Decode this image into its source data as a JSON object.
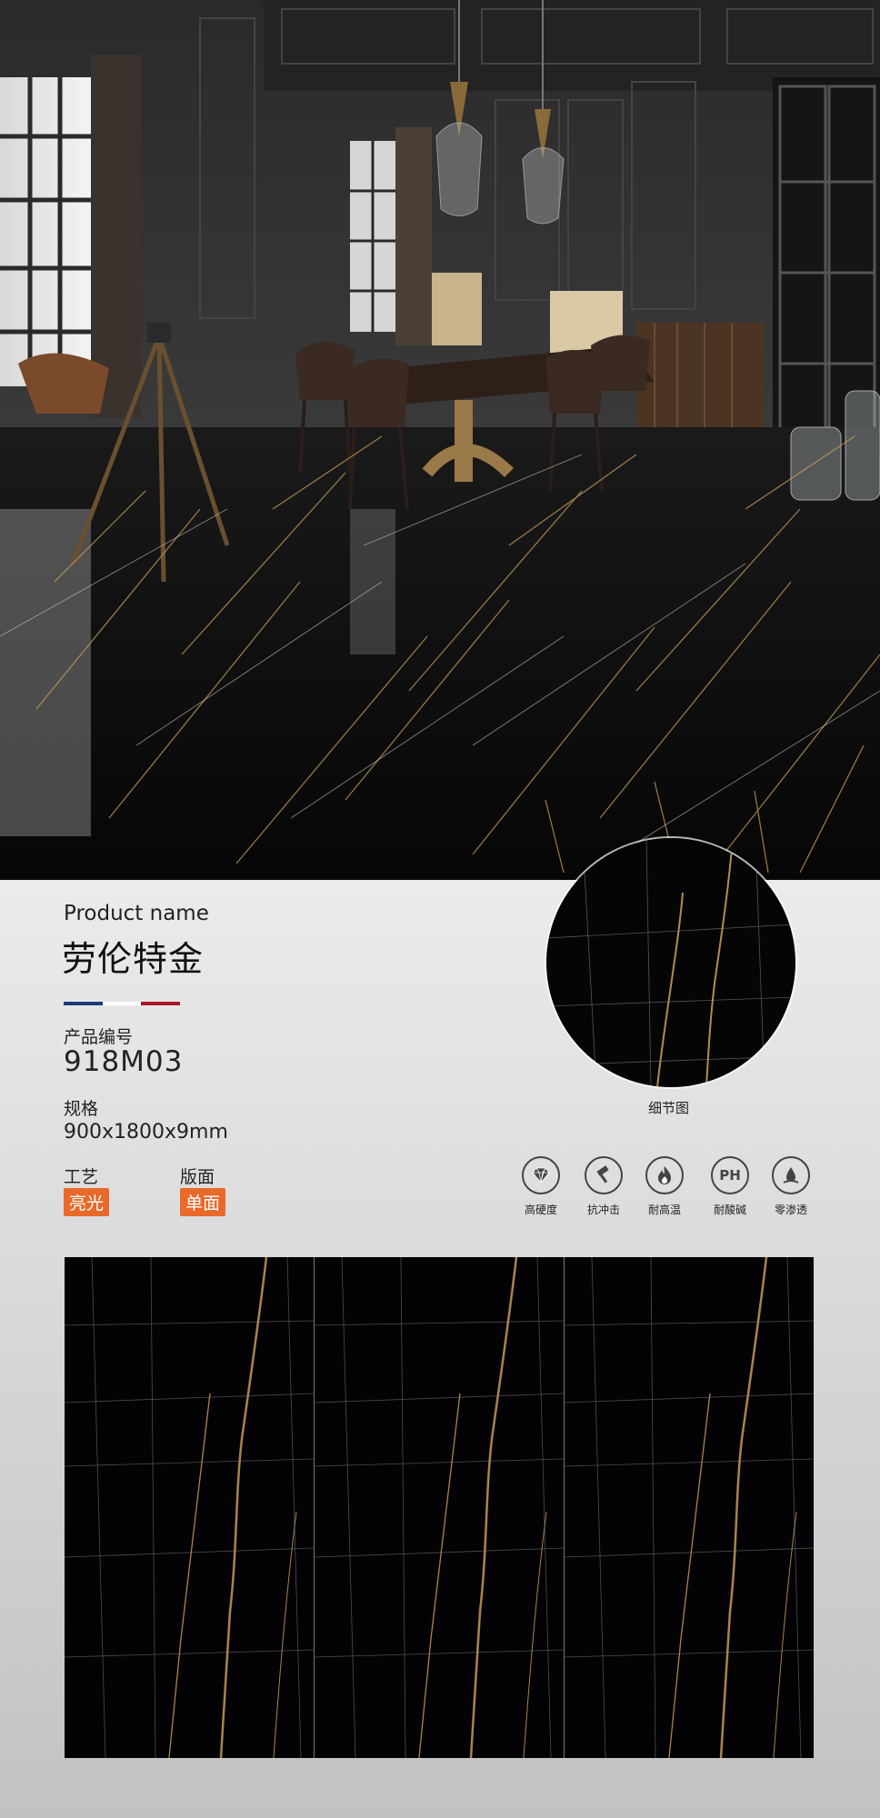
{
  "product": {
    "name_label": "Product name",
    "name": "劳伦特金",
    "code_label": "产品编号",
    "code": "918M03",
    "spec_label": "规格",
    "spec": "900x1800x9mm",
    "process_label": "工艺",
    "process": "亮光",
    "surface_label": "版面",
    "surface": "单面"
  },
  "detail": {
    "caption": "细节图"
  },
  "features": [
    {
      "label": "高硬度",
      "icon": "diamond-icon"
    },
    {
      "label": "抗冲击",
      "icon": "hammer-icon"
    },
    {
      "label": "耐高温",
      "icon": "flame-icon"
    },
    {
      "label": "耐酸碱",
      "icon": "ph-icon",
      "icon_text": "PH"
    },
    {
      "label": "零渗透",
      "icon": "water-drop-icon"
    }
  ],
  "colors": {
    "accent_orange": "#e8692a",
    "flag_blue": "#1f3a7a",
    "flag_white": "#ffffff",
    "flag_red": "#a8182a",
    "vein_gold": "#c89a5a",
    "marble_black": "#050505"
  }
}
